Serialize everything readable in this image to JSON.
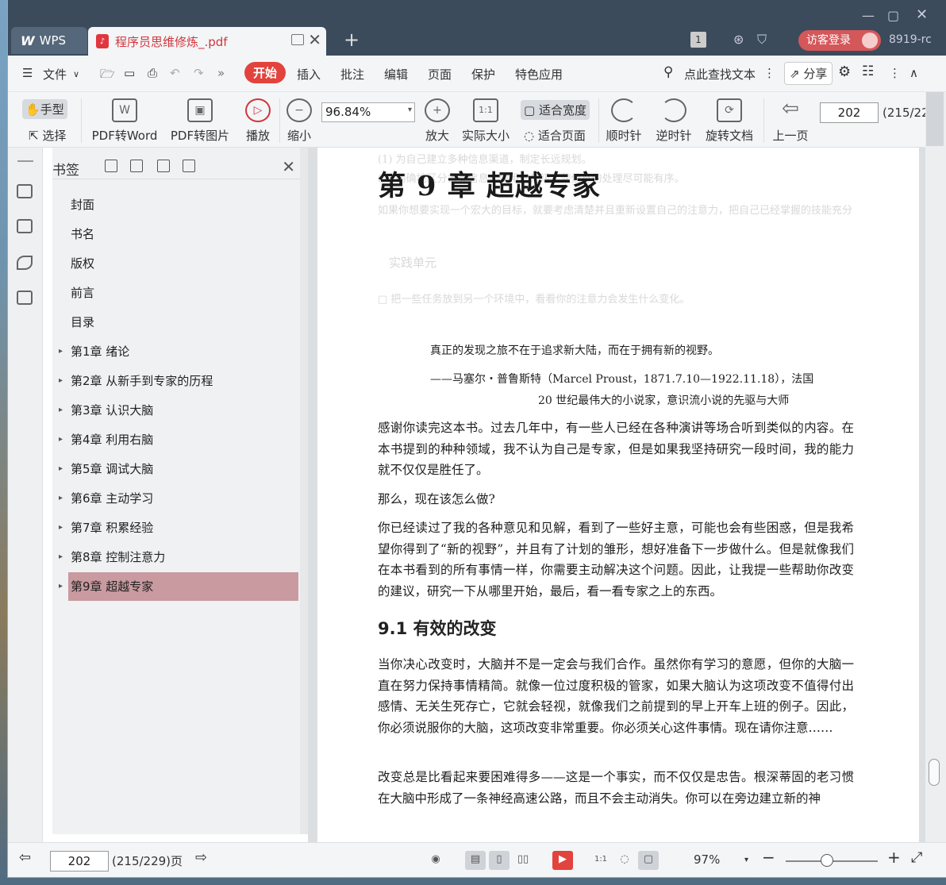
{
  "titlebar": {
    "wps_tab": "WPS",
    "doc_tab": "程序员思维修炼_.pdf",
    "page_badge": "1",
    "guest_login": "访客登录",
    "version": "8919-rc"
  },
  "menu": {
    "file": "文件",
    "items": [
      "开始",
      "插入",
      "批注",
      "编辑",
      "页面",
      "保护",
      "特色应用"
    ],
    "search": "点此查找文本",
    "share": "分享"
  },
  "toolbar": {
    "hand": "手型",
    "select": "选择",
    "pdf_to_word": "PDF转Word",
    "pdf_to_image": "PDF转图片",
    "play": "播放",
    "zoom_out": "缩小",
    "zoom_value": "96.84%",
    "zoom_in": "放大",
    "actual_size": "实际大小",
    "fit_width": "适合宽度",
    "fit_page": "适合页面",
    "clockwise": "顺时针",
    "counterclockwise": "逆时针",
    "rotate_doc": "旋转文档",
    "prev_page": "上一页",
    "page_input": "202",
    "page_total": "(215/22"
  },
  "bookmarks": {
    "title": "书签",
    "items": [
      {
        "label": "封面",
        "expandable": false
      },
      {
        "label": "书名",
        "expandable": false
      },
      {
        "label": "版权",
        "expandable": false
      },
      {
        "label": "前言",
        "expandable": false
      },
      {
        "label": "目录",
        "expandable": false
      },
      {
        "label": "第1章  绪论",
        "expandable": true
      },
      {
        "label": "第2章  从新手到专家的历程",
        "expandable": true
      },
      {
        "label": "第3章  认识大脑",
        "expandable": true
      },
      {
        "label": "第4章  利用右脑",
        "expandable": true
      },
      {
        "label": "第5章  调试大脑",
        "expandable": true
      },
      {
        "label": "第6章  主动学习",
        "expandable": true
      },
      {
        "label": "第7章  积累经验",
        "expandable": true
      },
      {
        "label": "第8章  控制注意力",
        "expandable": true
      },
      {
        "label": "第9章  超越专家",
        "expandable": true
      }
    ]
  },
  "page": {
    "chapter_title": "第 9 章    超越专家",
    "quote_line1": "真正的发现之旅不在于追求新大陆，而在于拥有新的视野。",
    "quote_line2": "——马塞尔・普鲁斯特（Marcel Proust，1871.7.10—1922.11.18），法国",
    "quote_line3": "20 世纪最伟大的小说家，意识流小说的先驱与大师",
    "p1": "感谢你读完这本书。过去几年中，有一些人已经在各种演讲等场合听到类似的内容。在本书提到的种种领域，我不认为自己是专家，但是如果我坚持研究一段时间，我的能力就不仅仅是胜任了。",
    "p2": "那么，现在该怎么做?",
    "p3": "你已经读过了我的各种意见和见解，看到了一些好主意，可能也会有些困惑，但是我希望你得到了“新的视野”，并且有了计划的雏形，想好准备下一步做什么。但是就像我们在本书看到的所有事情一样，你需要主动解决这个问题。因此，让我提一些帮助你改变的建议，研究一下从哪里开始，最后，看一看专家之上的东西。",
    "section": "9.1    有效的改变",
    "p4": "当你决心改变时，大脑并不是一定会与我们合作。虽然你有学习的意愿，但你的大脑一直在努力保持事情精简。就像一位过度积极的管家，如果大脑认为这项改变不值得付出感情、无关生死存亡，它就会轻视，就像我们之前提到的早上开车上班的例子。因此，你必须说服你的大脑，这项改变非常重要。你必须关心这件事情。现在请你注意……",
    "p5": "改变总是比看起来要困难得多——这是一个事实，而不仅仅是忠告。根深蒂固的老习惯在大脑中形成了一条神经高速公路，而且不会主动消失。你可以在旁边建立新的神"
  },
  "ghost_text": {
    "g1": "(1) 为自己建立多种信息渠道，制定长远规划。",
    "g2": "(2) 明确地区分各类信息，使用优先级，使信息的处理尽可能有序。",
    "g3": "如果你想要实现一个宏大的目标，就要考虑清楚并且重新设置自己的注意力，把自己已经掌握的技能充分",
    "g4": "实践单元",
    "g5": "□ 把一些任务放到另一个环境中，看看你的注意力会发生什么变化。"
  },
  "statusbar": {
    "page_input": "202",
    "page_info": "(215/229)页",
    "zoom": "97%"
  },
  "colors": {
    "accent": "#e2433c",
    "titlebar": "#3b4b5c",
    "selected_bookmark": "#c99aa0"
  }
}
